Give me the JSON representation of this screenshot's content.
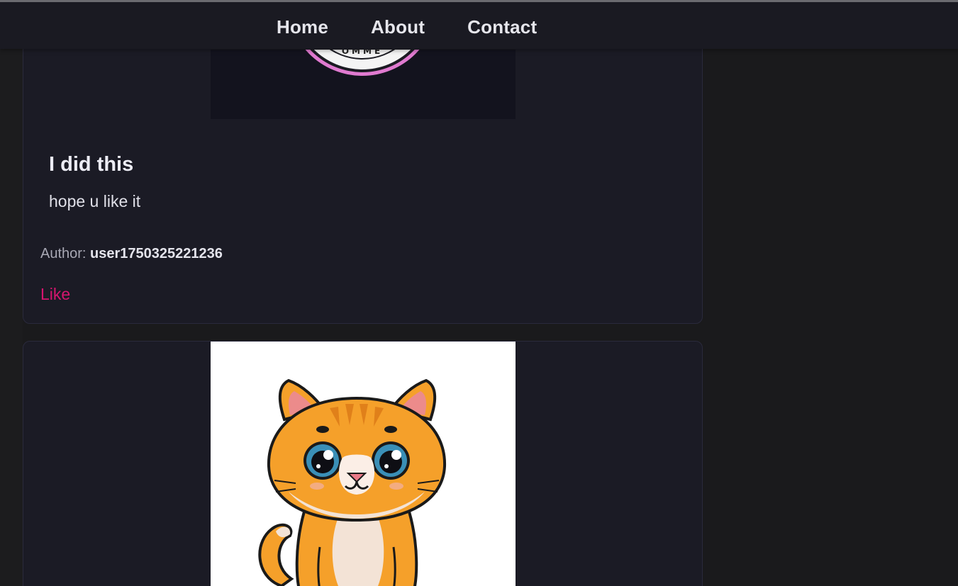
{
  "nav": {
    "links": [
      {
        "label": "Home"
      },
      {
        "label": "About"
      },
      {
        "label": "Contact"
      }
    ]
  },
  "posts": [
    {
      "image": {
        "icon": "badge-logo-image",
        "visible_text": "OMME"
      },
      "title": "I did this",
      "body": "hope u like it",
      "author_label": "Author:",
      "author_name": "user1750325221236",
      "like_label": "Like"
    },
    {
      "image": {
        "icon": "orange-cat-illustration"
      }
    }
  ],
  "colors": {
    "page_bg": "#1a1a1c",
    "card_bg": "#1b1b25",
    "like": "#d6156f",
    "badge_ring": "#e07ad0"
  }
}
